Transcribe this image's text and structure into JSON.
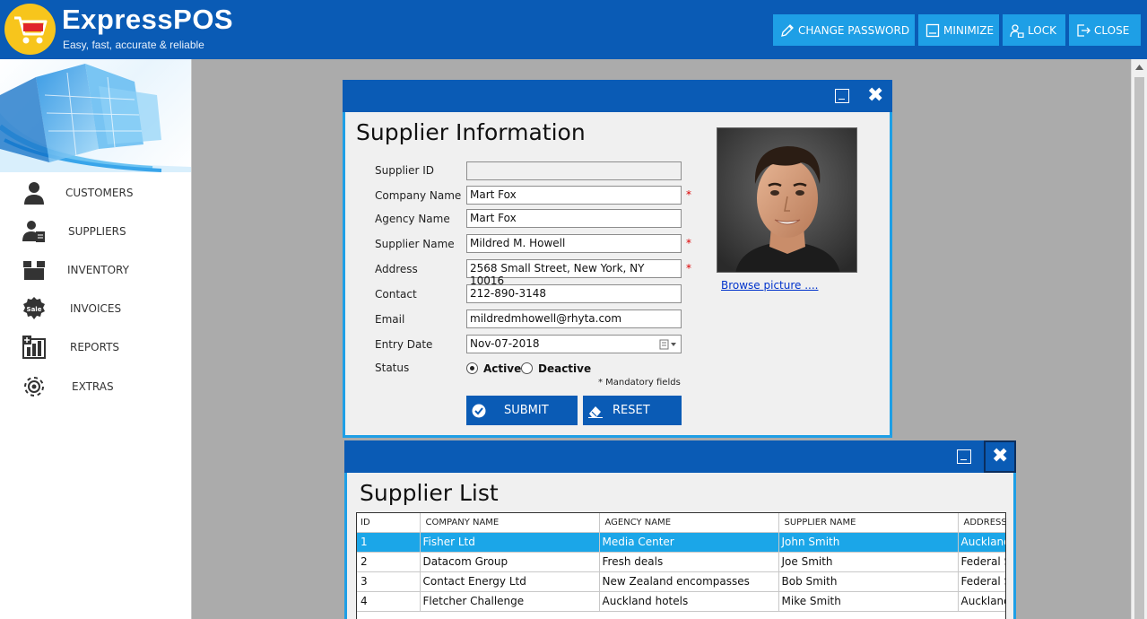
{
  "app": {
    "title": "ExpressPOS",
    "tagline": "Easy, fast, accurate & reliable"
  },
  "header_buttons": [
    {
      "label": "CHANGE PASSWORD",
      "icon": "pen-icon"
    },
    {
      "label": "MINIMIZE",
      "icon": "minimize-icon"
    },
    {
      "label": "LOCK",
      "icon": "user-lock-icon"
    },
    {
      "label": "CLOSE",
      "icon": "exit-icon"
    }
  ],
  "sidebar": {
    "items": [
      {
        "label": "CUSTOMERS",
        "icon": "person-icon"
      },
      {
        "label": "SUPPLIERS",
        "icon": "supplier-icon"
      },
      {
        "label": "INVENTORY",
        "icon": "box-icon"
      },
      {
        "label": "INVOICES",
        "icon": "sale-badge-icon",
        "badge_text": "Sale"
      },
      {
        "label": "REPORTS",
        "icon": "report-chart-icon"
      },
      {
        "label": "EXTRAS",
        "icon": "gear-icon"
      }
    ]
  },
  "supplier_form": {
    "title": "Supplier Information",
    "fields": {
      "supplier_id": {
        "label": "Supplier ID",
        "value": ""
      },
      "company_name": {
        "label": "Company Name",
        "value": "Mart Fox",
        "required": "*"
      },
      "agency_name": {
        "label": "Agency Name",
        "value": "Mart Fox"
      },
      "supplier_name": {
        "label": "Supplier Name",
        "value": "Mildred M. Howell",
        "required": "*"
      },
      "address": {
        "label": "Address",
        "value": "2568 Small Street, New York, NY 10016",
        "required": "*"
      },
      "contact": {
        "label": "Contact",
        "value": "212-890-3148"
      },
      "email": {
        "label": "Email",
        "value": "mildredmhowell@rhyta.com"
      },
      "entry_date": {
        "label": "Entry Date",
        "value": "Nov-07-2018"
      }
    },
    "status": {
      "label": "Status",
      "options": [
        {
          "label": "Active",
          "selected": true
        },
        {
          "label": "Deactive",
          "selected": false
        }
      ]
    },
    "mandatory_note": "* Mandatory fields",
    "submit_label": "SUBMIT",
    "reset_label": "RESET",
    "browse_label": "Browse picture ...."
  },
  "supplier_list": {
    "title": "Supplier List",
    "columns": [
      "ID",
      "COMPANY NAME",
      "AGENCY NAME",
      "SUPPLIER NAME",
      "ADDRESS"
    ],
    "rows": [
      [
        "1",
        "Fisher Ltd",
        "Media Center",
        "John Smith",
        "Auckland"
      ],
      [
        "2",
        "Datacom Group",
        "Fresh deals",
        "Joe Smith",
        "Federal S"
      ],
      [
        "3",
        "Contact Energy Ltd",
        "New Zealand encompasses",
        "Bob Smith",
        "Federal S"
      ],
      [
        "4",
        "Fletcher Challenge",
        "Auckland hotels",
        "Mike Smith",
        "Auckland"
      ]
    ],
    "selected_row": 0
  },
  "colors": {
    "primary": "#0a5bb5",
    "accent": "#1e9fe6",
    "selection": "#1ba6e8",
    "logo": "#f7c51c"
  }
}
